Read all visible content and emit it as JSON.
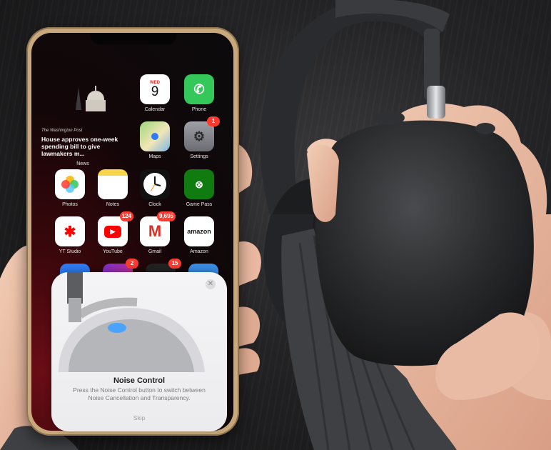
{
  "news_widget": {
    "source": "The Washington Post",
    "headline": "House approves one-week spending bill to give lawmakers m...",
    "label": "News"
  },
  "apps": {
    "calendar": {
      "label": "Calendar",
      "weekday": "WED",
      "day": "9"
    },
    "phone": {
      "label": "Phone"
    },
    "maps": {
      "label": "Maps"
    },
    "settings": {
      "label": "Settings",
      "badge": "1"
    },
    "photos": {
      "label": "Photos"
    },
    "notes": {
      "label": "Notes"
    },
    "clock": {
      "label": "Clock"
    },
    "game_pass": {
      "label": "Game Pass"
    },
    "yt_studio": {
      "label": "YT Studio"
    },
    "youtube": {
      "label": "YouTube",
      "badge": "124"
    },
    "gmail": {
      "label": "Gmail",
      "badge": "9,695"
    },
    "amazon": {
      "label": "Amazon",
      "icon_text": "amazon"
    },
    "row5": {
      "badge_a": "2",
      "badge_b": "15"
    }
  },
  "noise_control_card": {
    "title": "Noise Control",
    "description": "Press the Noise Control button to switch between Noise Cancellation and Transparency.",
    "skip_label": "Skip",
    "close_icon": "close-icon"
  },
  "colors": {
    "wallpaper_red": "#6b0d15",
    "headphone_body": "#2b2c2e",
    "noise_control_button_glow": "#4aa3ff"
  }
}
